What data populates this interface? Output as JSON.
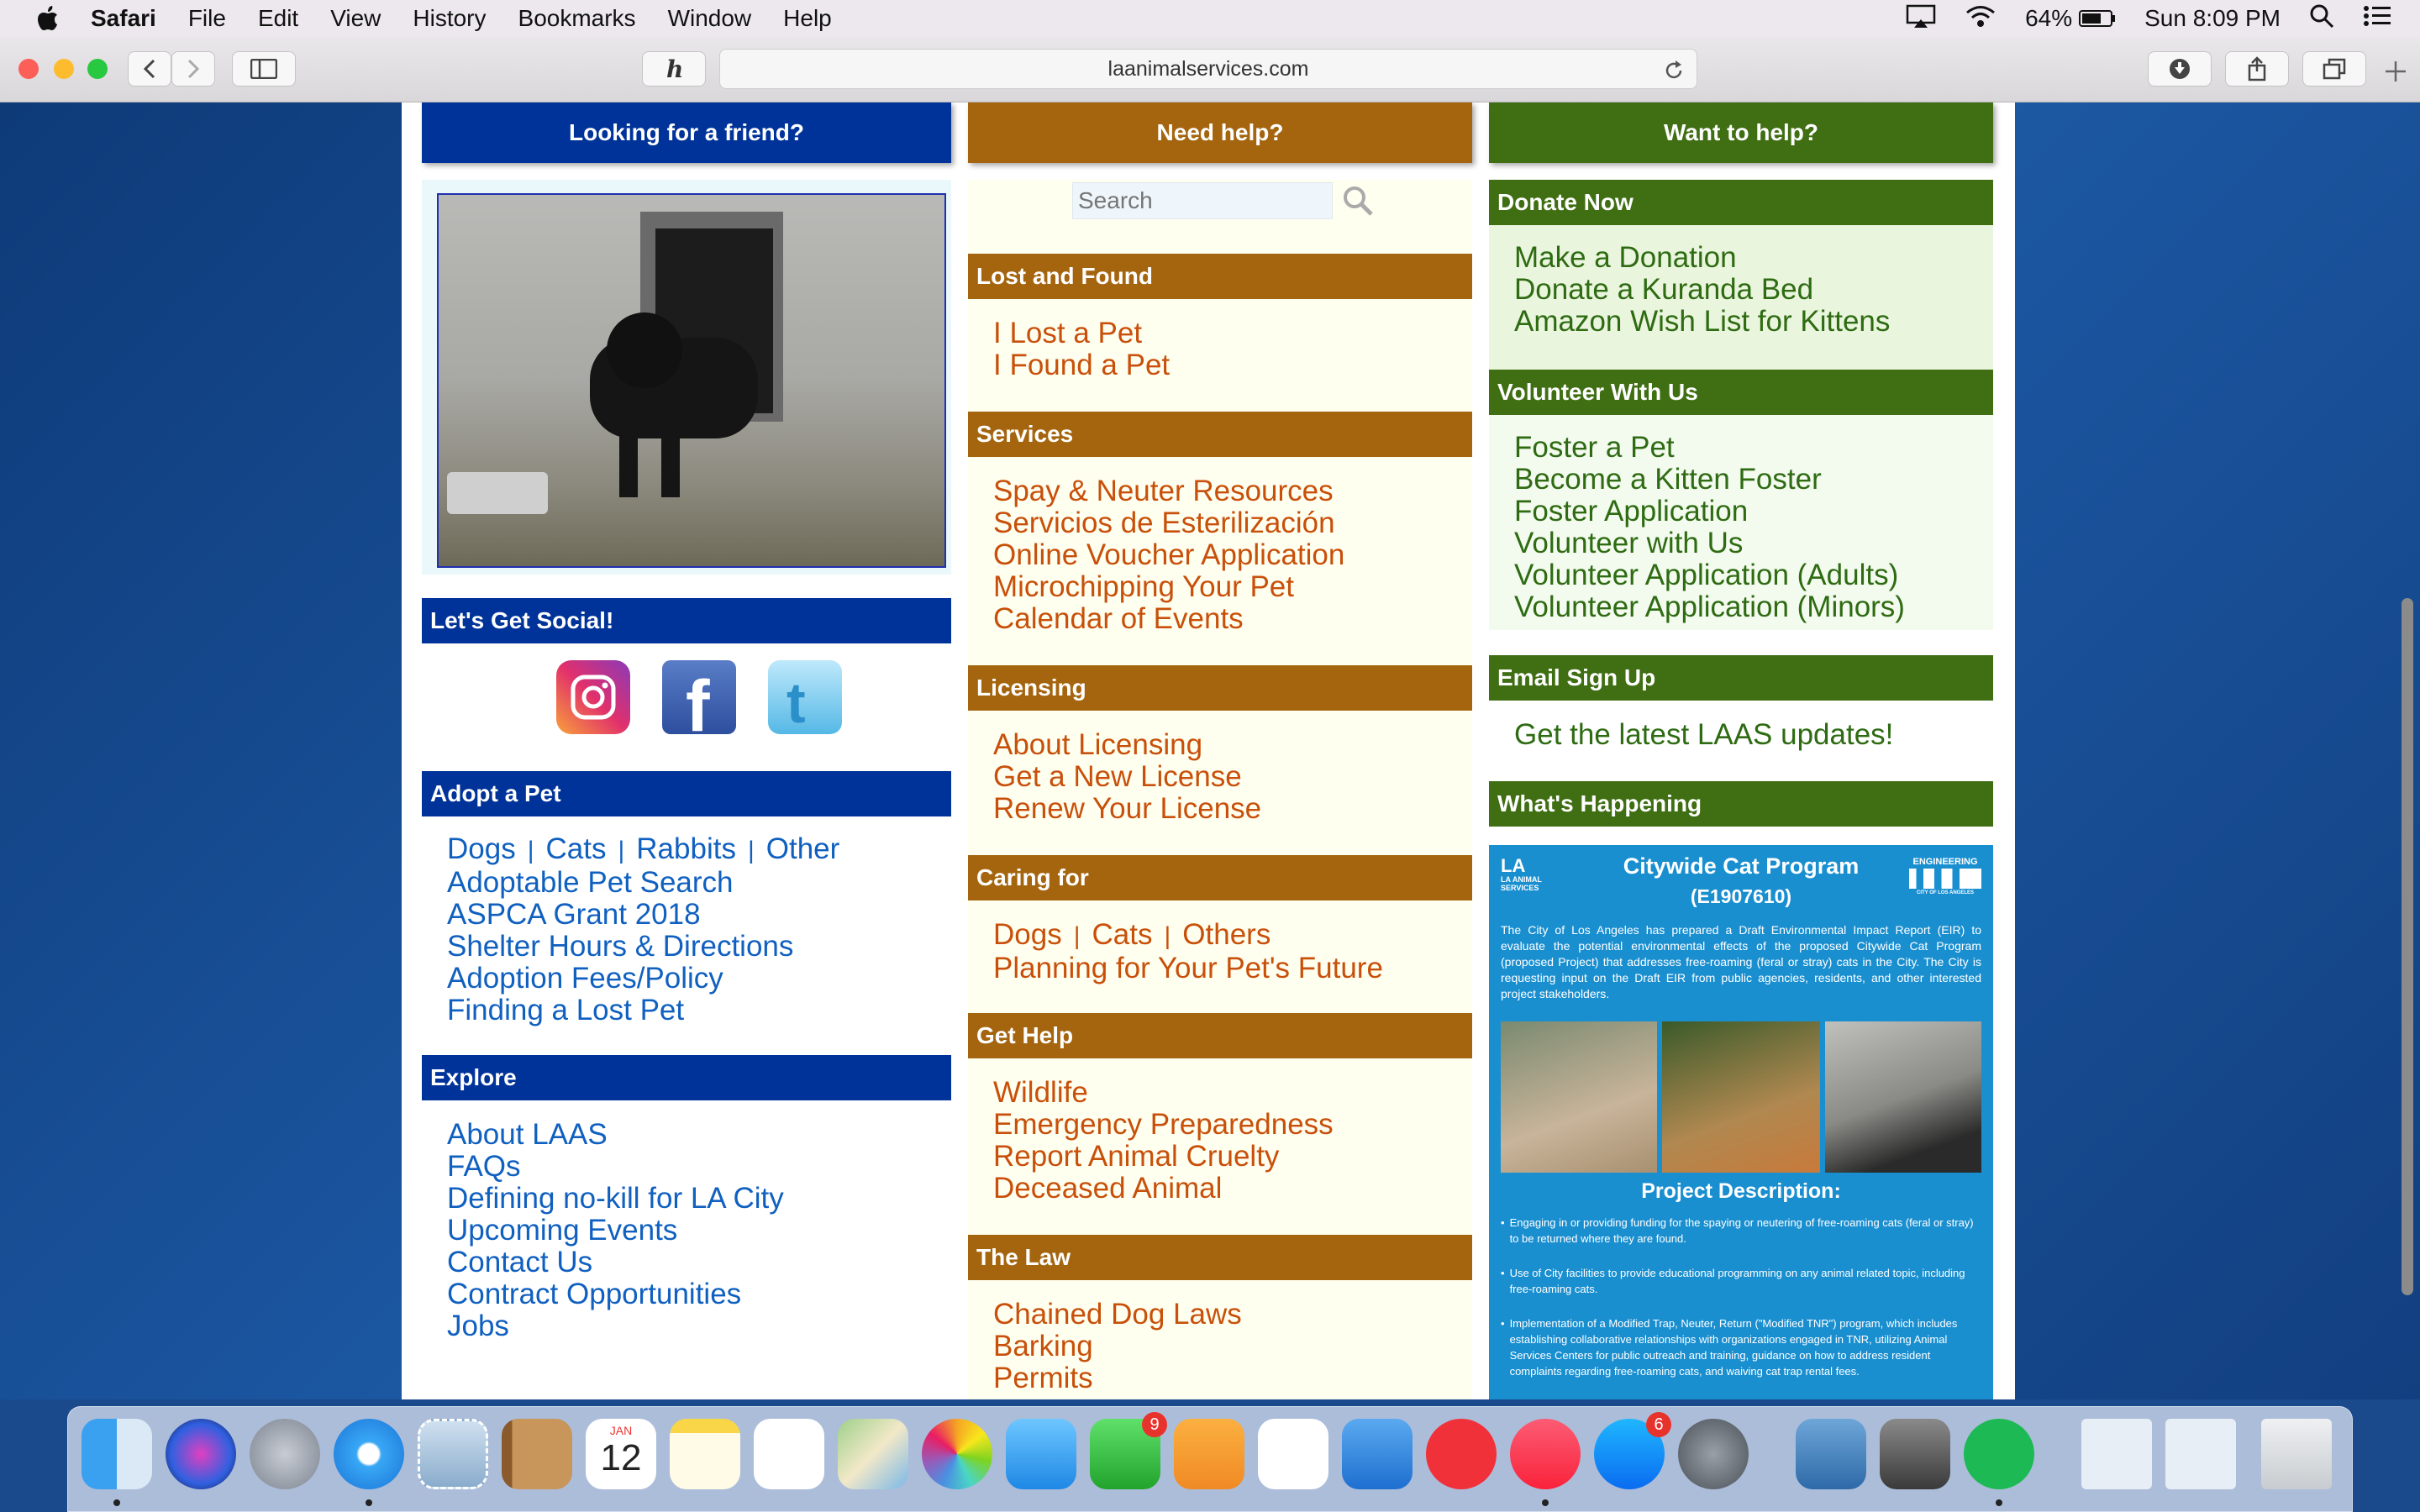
{
  "menubar": {
    "app": "Safari",
    "items": [
      "File",
      "Edit",
      "View",
      "History",
      "Bookmarks",
      "Window",
      "Help"
    ],
    "battery": "64%",
    "clock": "Sun 8:09 PM"
  },
  "browser": {
    "url": "laanimalservices.com"
  },
  "columns": {
    "left": {
      "header": "Looking for a friend?"
    },
    "middle": {
      "header": "Need help?"
    },
    "right": {
      "header": "Want to help?"
    }
  },
  "search": {
    "placeholder": "Search"
  },
  "social": {
    "title": "Let's Get Social!"
  },
  "adopt": {
    "title": "Adopt a Pet",
    "species": [
      "Dogs",
      "Cats",
      "Rabbits",
      "Other"
    ],
    "links": [
      "Adoptable Pet Search",
      "ASPCA Grant 2018",
      "Shelter Hours & Directions",
      "Adoption Fees/Policy",
      "Finding a Lost Pet"
    ]
  },
  "explore": {
    "title": "Explore",
    "links": [
      "About LAAS",
      "FAQs",
      "Defining no-kill for LA City",
      "Upcoming Events",
      "Contact Us",
      "Contract Opportunities",
      "Jobs"
    ]
  },
  "lost_found": {
    "title": "Lost and Found",
    "links": [
      "I Lost a Pet",
      "I Found a Pet"
    ]
  },
  "services": {
    "title": "Services",
    "links": [
      "Spay & Neuter Resources",
      "Servicios de Esterilización",
      "Online Voucher Application",
      "Microchipping Your Pet",
      "Calendar of Events"
    ]
  },
  "licensing": {
    "title": "Licensing",
    "links": [
      "About Licensing",
      "Get a New License",
      "Renew Your License"
    ]
  },
  "caring": {
    "title": "Caring for",
    "species": [
      "Dogs",
      "Cats",
      "Others"
    ],
    "link": "Planning for Your Pet's Future"
  },
  "get_help": {
    "title": "Get Help",
    "links": [
      "Wildlife",
      "Emergency Preparedness",
      "Report Animal Cruelty",
      "Deceased Animal"
    ]
  },
  "law": {
    "title": "The Law",
    "links": [
      "Chained Dog Laws",
      "Barking",
      "Permits"
    ]
  },
  "donate": {
    "title": "Donate Now",
    "links": [
      "Make a Donation",
      "Donate a Kuranda Bed",
      "Amazon Wish List for Kittens"
    ]
  },
  "volunteer": {
    "title": "Volunteer With Us",
    "links": [
      "Foster a Pet",
      "Become a Kitten Foster",
      "Foster Application",
      "Volunteer with Us",
      "Volunteer Application (Adults)",
      "Volunteer Application (Minors)"
    ]
  },
  "email": {
    "title": "Email Sign Up",
    "link": "Get the latest LAAS updates!"
  },
  "happening": {
    "title": "What's Happening",
    "poster_title": "Citywide Cat Program",
    "poster_code": "(E1907610)",
    "logo_left": "LA ANIMAL SERVICES",
    "logo_right": "ENGINEERING",
    "logo_right_sub": "CITY OF LOS ANGELES",
    "intro": "The City of Los Angeles has prepared a Draft Environmental Impact Report (EIR) to evaluate the potential environmental effects of the proposed Citywide Cat Program (proposed Project) that addresses free-roaming (feral or stray) cats in the City. The City is requesting input on the Draft EIR from public agencies, residents, and other interested project stakeholders.",
    "desc_title": "Project Description:",
    "bullets": [
      "Engaging in or providing funding for the spaying or neutering of free-roaming cats (feral or stray) to be returned where they are found.",
      "Use of City facilities to provide educational programming on any animal related topic, including free-roaming cats.",
      "Implementation of a Modified Trap, Neuter, Return (\"Modified TNR\") program, which includes establishing collaborative relationships with organizations engaged in TNR, utilizing Animal Services Centers for public outreach and training, guidance on how to address resident complaints regarding free-roaming cats, and waiving cat trap rental fees."
    ]
  },
  "dock": {
    "calendar_month": "JAN",
    "calendar_day": "12",
    "facetime_badge": "9",
    "appstore_badge": "6"
  },
  "colors": {
    "blue": "#003399",
    "brown": "#a5650f",
    "green": "#3f6e13"
  }
}
